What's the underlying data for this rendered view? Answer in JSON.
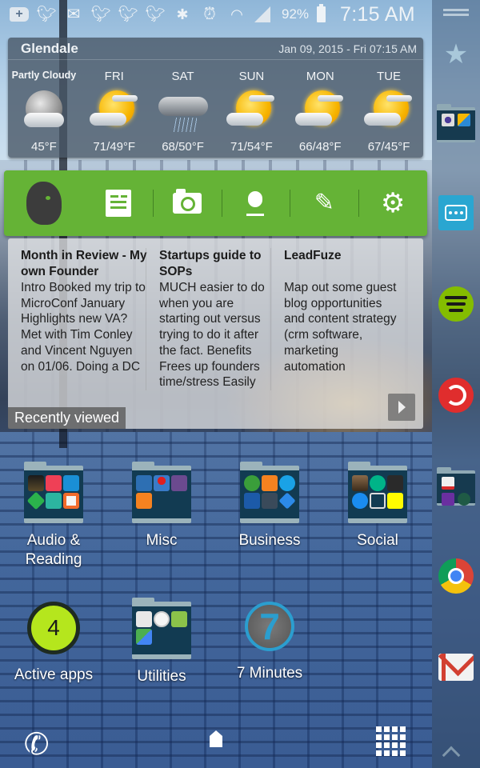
{
  "status_bar": {
    "notification_icons": [
      "add-icon",
      "twitter-icon",
      "mail-icon",
      "twitter-icon",
      "twitter-icon",
      "twitter-icon"
    ],
    "system_icons": [
      "bluetooth-icon",
      "alarm-icon",
      "wifi-icon",
      "signal-icon"
    ],
    "battery": "92%",
    "time": "7:15 AM"
  },
  "weather": {
    "city": "Glendale",
    "datetime": "Jan 09, 2015 - Fri 07:15 AM",
    "current": {
      "label": "Partly Cloudy",
      "temp": "45°F",
      "icon": "partly-cloudy-night-icon"
    },
    "forecast": [
      {
        "day": "FRI",
        "temp": "71/49°F",
        "icon": "partly-sunny-icon"
      },
      {
        "day": "SAT",
        "temp": "68/50°F",
        "icon": "rain-icon"
      },
      {
        "day": "SUN",
        "temp": "71/54°F",
        "icon": "partly-sunny-icon"
      },
      {
        "day": "MON",
        "temp": "66/48°F",
        "icon": "partly-sunny-icon"
      },
      {
        "day": "TUE",
        "temp": "67/45°F",
        "icon": "partly-sunny-icon"
      }
    ]
  },
  "evernote": {
    "brand_color": "#65b336",
    "actions": [
      "new-note",
      "camera",
      "audio-note",
      "handwriting",
      "settings"
    ]
  },
  "notes": {
    "items": [
      {
        "title": "Month in Review - My own Founder",
        "body": "Intro Booked my trip to MicroConf January Highlights new VA? Met with Tim Conley and Vincent Nguyen on 01/06. Doing a DC"
      },
      {
        "title": "Startups guide to SOPs",
        "body": "MUCH easier to do when you are starting out versus trying to do it after the fact. Benefits Frees up founders time/stress Easily"
      },
      {
        "title": "LeadFuze",
        "body": "Map out some guest blog opportunities and content strategy (crm software, marketing automation"
      }
    ],
    "footer_label": "Recently viewed"
  },
  "home": {
    "folders": [
      {
        "label": "Audio & Reading",
        "apps": [
          "kindle",
          "pocket",
          "shazam",
          "feedly",
          "audible",
          "xodo"
        ]
      },
      {
        "label": "Misc",
        "apps": [
          "popcorn",
          "map-pin",
          "bull",
          "alarm"
        ]
      },
      {
        "label": "Business",
        "apps": [
          "evernote-green",
          "pacman",
          "skype",
          "chase",
          "signal",
          "dropbox"
        ]
      },
      {
        "label": "Social",
        "apps": [
          "instagram",
          "vine",
          "hootsuite",
          "messenger",
          "buffer",
          "snapchat"
        ]
      }
    ],
    "row2": {
      "active_apps": {
        "label": "Active apps",
        "count": "4"
      },
      "utilities": {
        "label": "Utilities",
        "apps": [
          "play-store",
          "clock",
          "calculator",
          "maps"
        ]
      },
      "seven_minutes": {
        "label": "7 Minutes",
        "glyph": "7"
      }
    }
  },
  "side_dock": {
    "items": [
      "star",
      "camera-gallery-folder",
      "messages",
      "spotify",
      "pocket-casts",
      "sports-folder",
      "chrome",
      "gmail"
    ]
  }
}
